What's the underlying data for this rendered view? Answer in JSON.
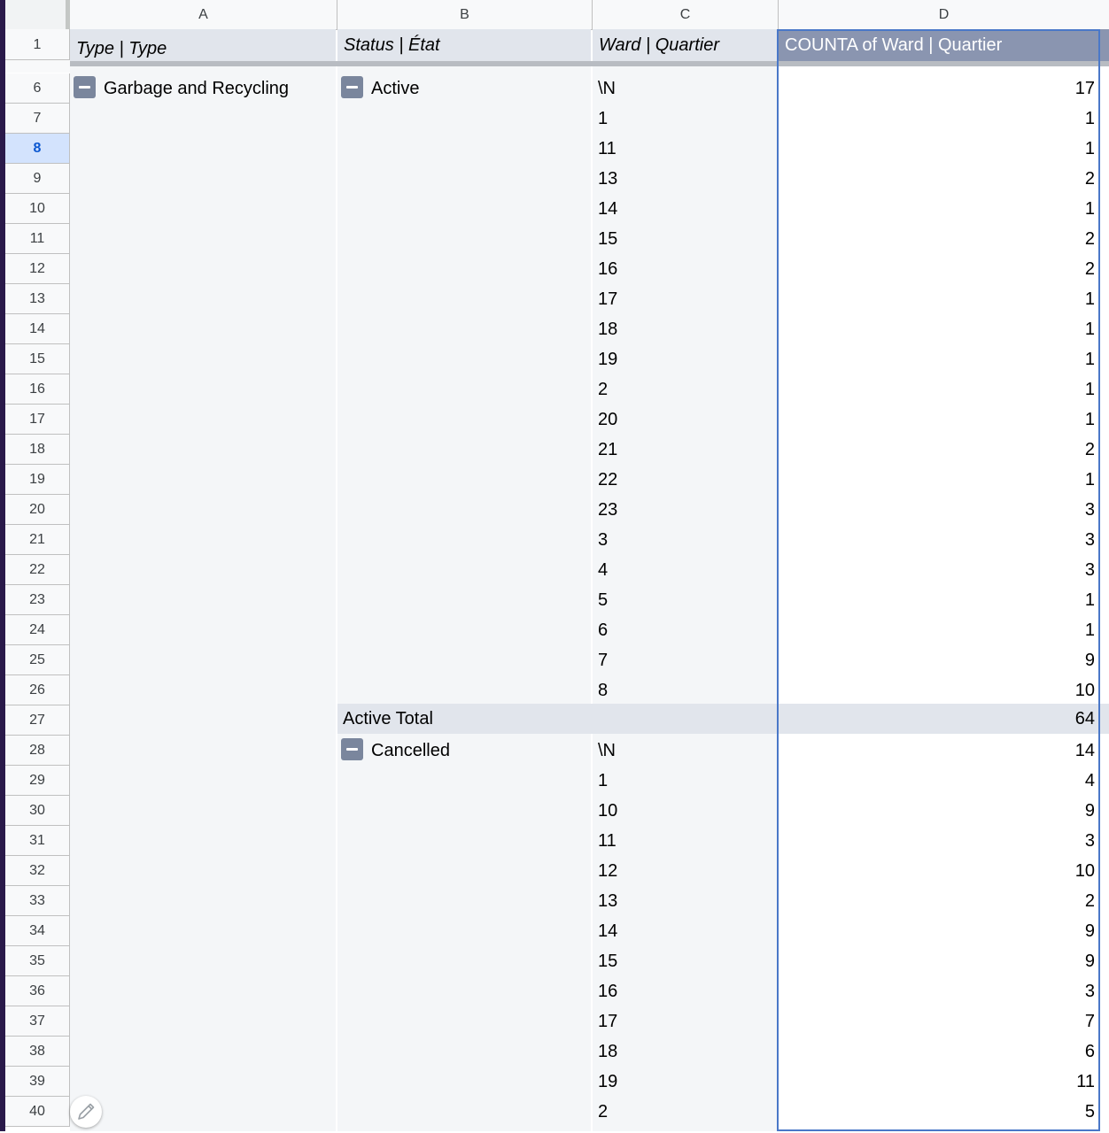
{
  "columns": [
    "A",
    "B",
    "C",
    "D"
  ],
  "selected_row": "8",
  "header_row_number": "1",
  "headers": {
    "type": "Type | Type",
    "status": "Status | État",
    "ward": "Ward | Quartier",
    "count": "COUNTA of Ward | Quartier"
  },
  "type_group": "Garbage and Recycling",
  "groups": {
    "active": {
      "label": "Active",
      "rows": [
        {
          "row": "6",
          "ward": "\\N",
          "count": "17"
        },
        {
          "row": "7",
          "ward": "1",
          "count": "1"
        },
        {
          "row": "8",
          "ward": "11",
          "count": "1"
        },
        {
          "row": "9",
          "ward": "13",
          "count": "2"
        },
        {
          "row": "10",
          "ward": "14",
          "count": "1"
        },
        {
          "row": "11",
          "ward": "15",
          "count": "2"
        },
        {
          "row": "12",
          "ward": "16",
          "count": "2"
        },
        {
          "row": "13",
          "ward": "17",
          "count": "1"
        },
        {
          "row": "14",
          "ward": "18",
          "count": "1"
        },
        {
          "row": "15",
          "ward": "19",
          "count": "1"
        },
        {
          "row": "16",
          "ward": "2",
          "count": "1"
        },
        {
          "row": "17",
          "ward": "20",
          "count": "1"
        },
        {
          "row": "18",
          "ward": "21",
          "count": "2"
        },
        {
          "row": "19",
          "ward": "22",
          "count": "1"
        },
        {
          "row": "20",
          "ward": "23",
          "count": "3"
        },
        {
          "row": "21",
          "ward": "3",
          "count": "3"
        },
        {
          "row": "22",
          "ward": "4",
          "count": "3"
        },
        {
          "row": "23",
          "ward": "5",
          "count": "1"
        },
        {
          "row": "24",
          "ward": "6",
          "count": "1"
        },
        {
          "row": "25",
          "ward": "7",
          "count": "9"
        },
        {
          "row": "26",
          "ward": "8",
          "count": "10"
        }
      ],
      "total": {
        "row": "27",
        "label": "Active Total",
        "count": "64"
      }
    },
    "cancelled": {
      "label": "Cancelled",
      "rows": [
        {
          "row": "28",
          "ward": "\\N",
          "count": "14"
        },
        {
          "row": "29",
          "ward": "1",
          "count": "4"
        },
        {
          "row": "30",
          "ward": "10",
          "count": "9"
        },
        {
          "row": "31",
          "ward": "11",
          "count": "3"
        },
        {
          "row": "32",
          "ward": "12",
          "count": "10"
        },
        {
          "row": "33",
          "ward": "13",
          "count": "2"
        },
        {
          "row": "34",
          "ward": "14",
          "count": "9"
        },
        {
          "row": "35",
          "ward": "15",
          "count": "9"
        },
        {
          "row": "36",
          "ward": "16",
          "count": "3"
        },
        {
          "row": "37",
          "ward": "17",
          "count": "7"
        },
        {
          "row": "38",
          "ward": "18",
          "count": "6"
        },
        {
          "row": "39",
          "ward": "19",
          "count": "11"
        },
        {
          "row": "40",
          "ward": "2",
          "count": "5"
        }
      ]
    }
  },
  "icons": {
    "collapse": "minus-box-icon",
    "edit": "pencil-icon"
  },
  "colors": {
    "selection": "#4a78c8",
    "pivot_header": "#8a95b0",
    "subtotal": "#e1e5ec"
  }
}
